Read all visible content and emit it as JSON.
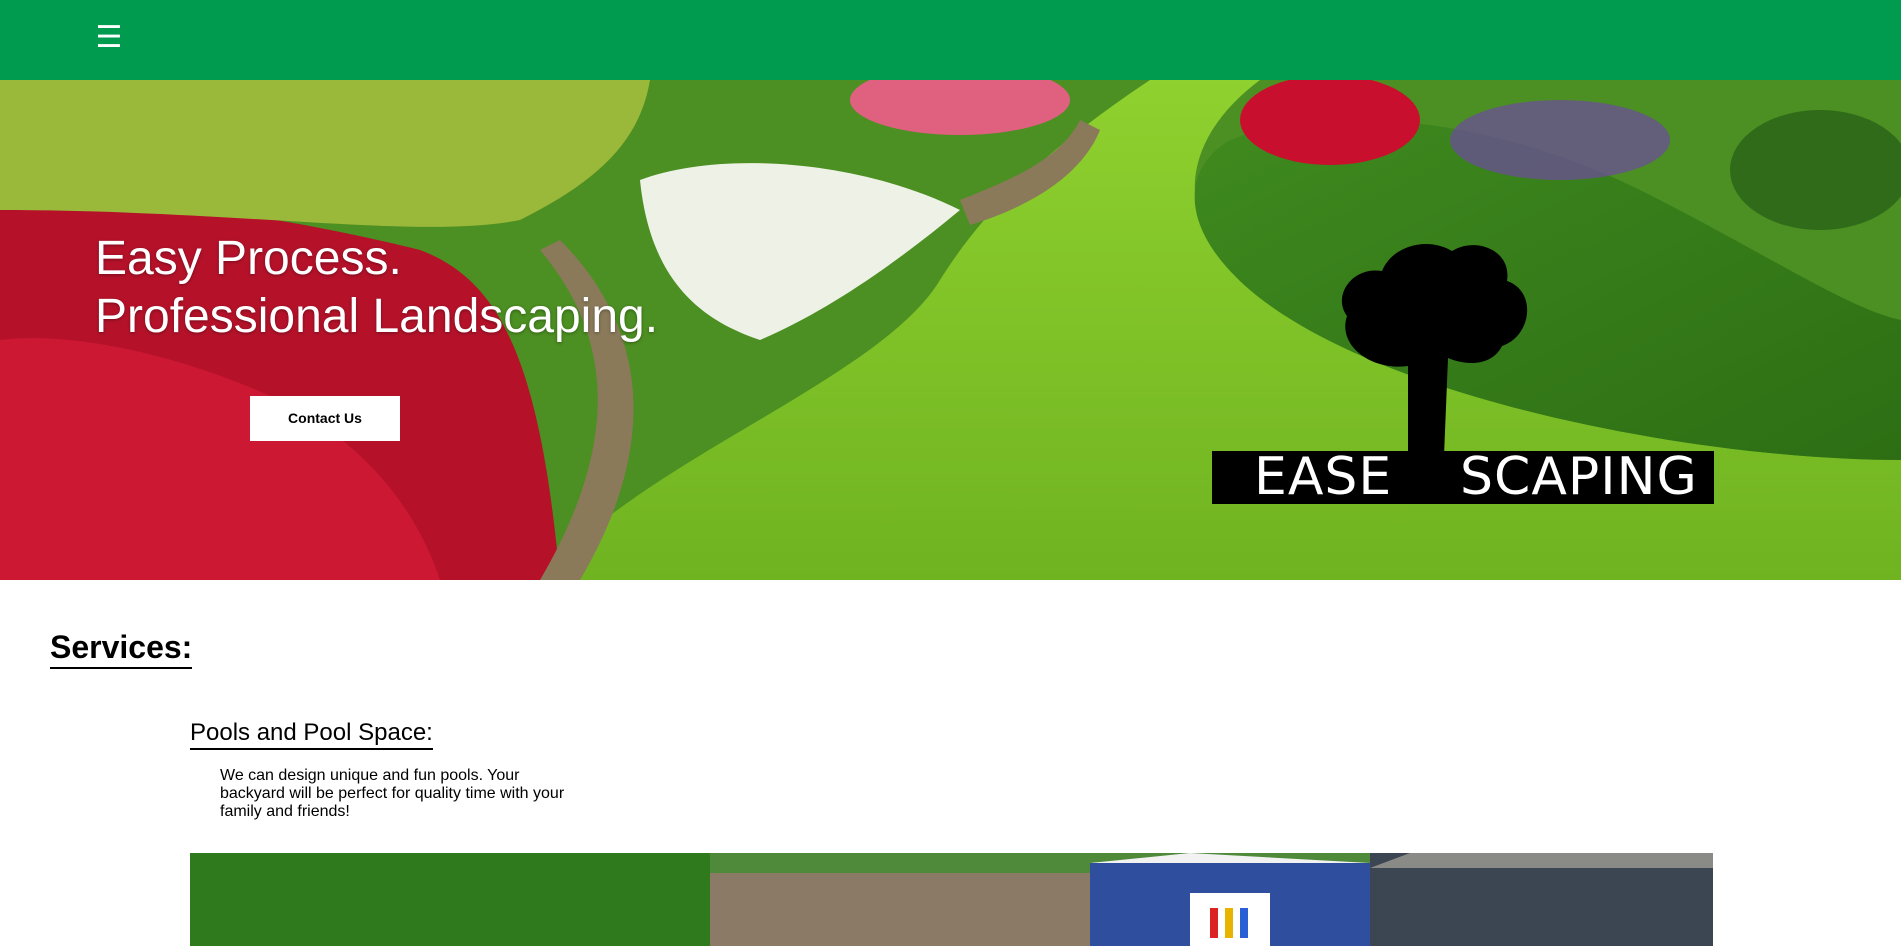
{
  "header": {
    "menu_icon": "hamburger-menu-icon",
    "menu_glyph": "☰",
    "background_color": "#009b4e"
  },
  "hero": {
    "headline_line1": "Easy Process.",
    "headline_line2": "Professional Landscaping.",
    "contact_button_label": "Contact Us",
    "logo": {
      "word1": "EASE",
      "word2": "SCAPING",
      "icon": "tree-icon"
    }
  },
  "services": {
    "heading": "Services:",
    "items": [
      {
        "title": "Pools and Pool Space:",
        "description": "We can design unique and fun pools. Your backyard will be perfect for quality time with your family and friends!"
      }
    ]
  },
  "colors": {
    "accent_green": "#009b4e",
    "logo_black": "#000000"
  }
}
